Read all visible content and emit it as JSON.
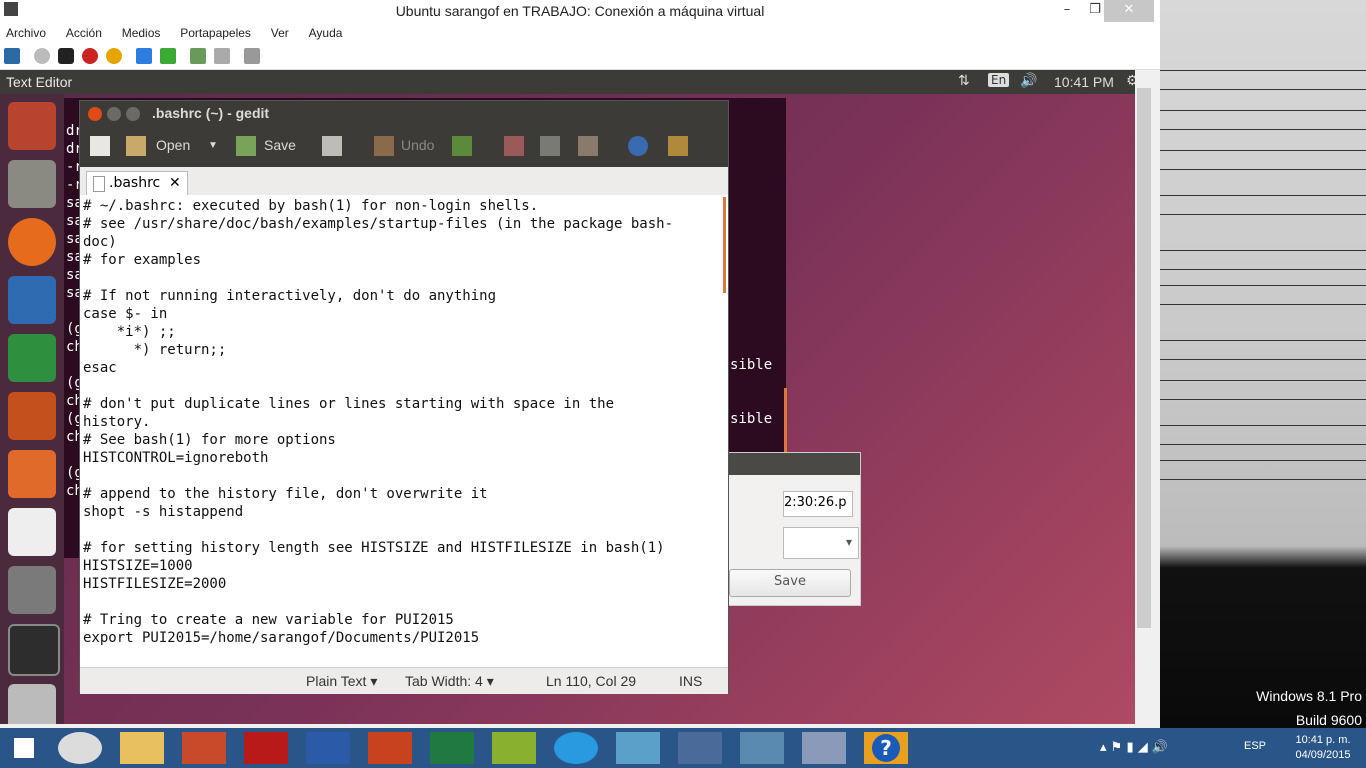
{
  "vm": {
    "title": "Ubuntu sarangof en TRABAJO: Conexión a máquina virtual",
    "menu": [
      "Archivo",
      "Acción",
      "Medios",
      "Portapapeles",
      "Ver",
      "Ayuda"
    ]
  },
  "ubuntu": {
    "panel_title": "Text Editor",
    "keyboard": "En",
    "time": "10:41 PM"
  },
  "gedit": {
    "title": ".bashrc (~) - gedit",
    "toolbar": {
      "open": "Open",
      "save": "Save",
      "undo": "Undo"
    },
    "tab": ".bashrc",
    "code": [
      "# ~/.bashrc: executed by bash(1) for non-login shells.",
      "# see /usr/share/doc/bash/examples/startup-files (in the package bash-",
      "doc)",
      "# for examples",
      "",
      "# If not running interactively, don't do anything",
      "case $- in",
      "    *i*) ;;",
      "      *) return;;",
      "esac",
      "",
      "# don't put duplicate lines or lines starting with space in the",
      "history.",
      "# See bash(1) for more options",
      "HISTCONTROL=ignoreboth",
      "",
      "# append to the history file, don't overwrite it",
      "shopt -s histappend",
      "",
      "# for setting history length see HISTSIZE and HISTFILESIZE in bash(1)",
      "HISTSIZE=1000",
      "HISTFILESIZE=2000",
      "",
      "# Tring to create a new variable for PUI2015",
      "export PUI2015=/home/sarangof/Documents/PUI2015"
    ],
    "status": {
      "lang": "Plain Text",
      "tab": "Tab Width: 4",
      "pos": "Ln 110, Col 29",
      "mode": "INS"
    }
  },
  "terminal": {
    "left": [
      "dr",
      "dr",
      "-r",
      "-r",
      "sa",
      "sa",
      "sa",
      "sa",
      "sa",
      "sa",
      "",
      "(g",
      "ch",
      "",
      "(g",
      "ch",
      "(g",
      "ch",
      "",
      "(g",
      "ch"
    ],
    "right": [
      "sible",
      "sible",
      "sible",
      "sible"
    ]
  },
  "dialog": {
    "field": "2:30:26.p",
    "save": "Save"
  },
  "windows": {
    "edition": "Windows 8.1 Pro",
    "build": "Build 9600",
    "lang": "ESP",
    "time": "10:41 p. m.",
    "date": "04/09/2015"
  }
}
